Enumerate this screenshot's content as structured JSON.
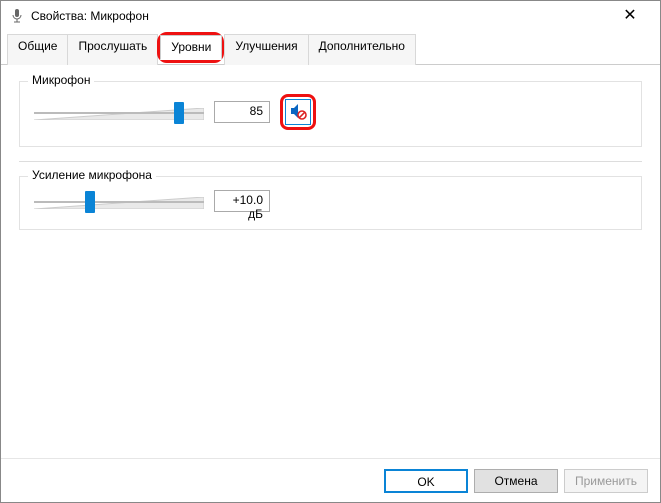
{
  "window": {
    "title": "Свойства: Микрофон"
  },
  "tabs": [
    {
      "label": "Общие"
    },
    {
      "label": "Прослушать"
    },
    {
      "label": "Уровни",
      "active": true
    },
    {
      "label": "Улучшения"
    },
    {
      "label": "Дополнительно"
    }
  ],
  "levels": {
    "mic": {
      "title": "Микрофон",
      "value": "85",
      "percent": 85,
      "muted": true
    },
    "boost": {
      "title": "Усиление микрофона",
      "value": "+10.0 дБ",
      "percent": 33
    }
  },
  "footer": {
    "ok": "OK",
    "cancel": "Отмена",
    "apply": "Применить"
  }
}
